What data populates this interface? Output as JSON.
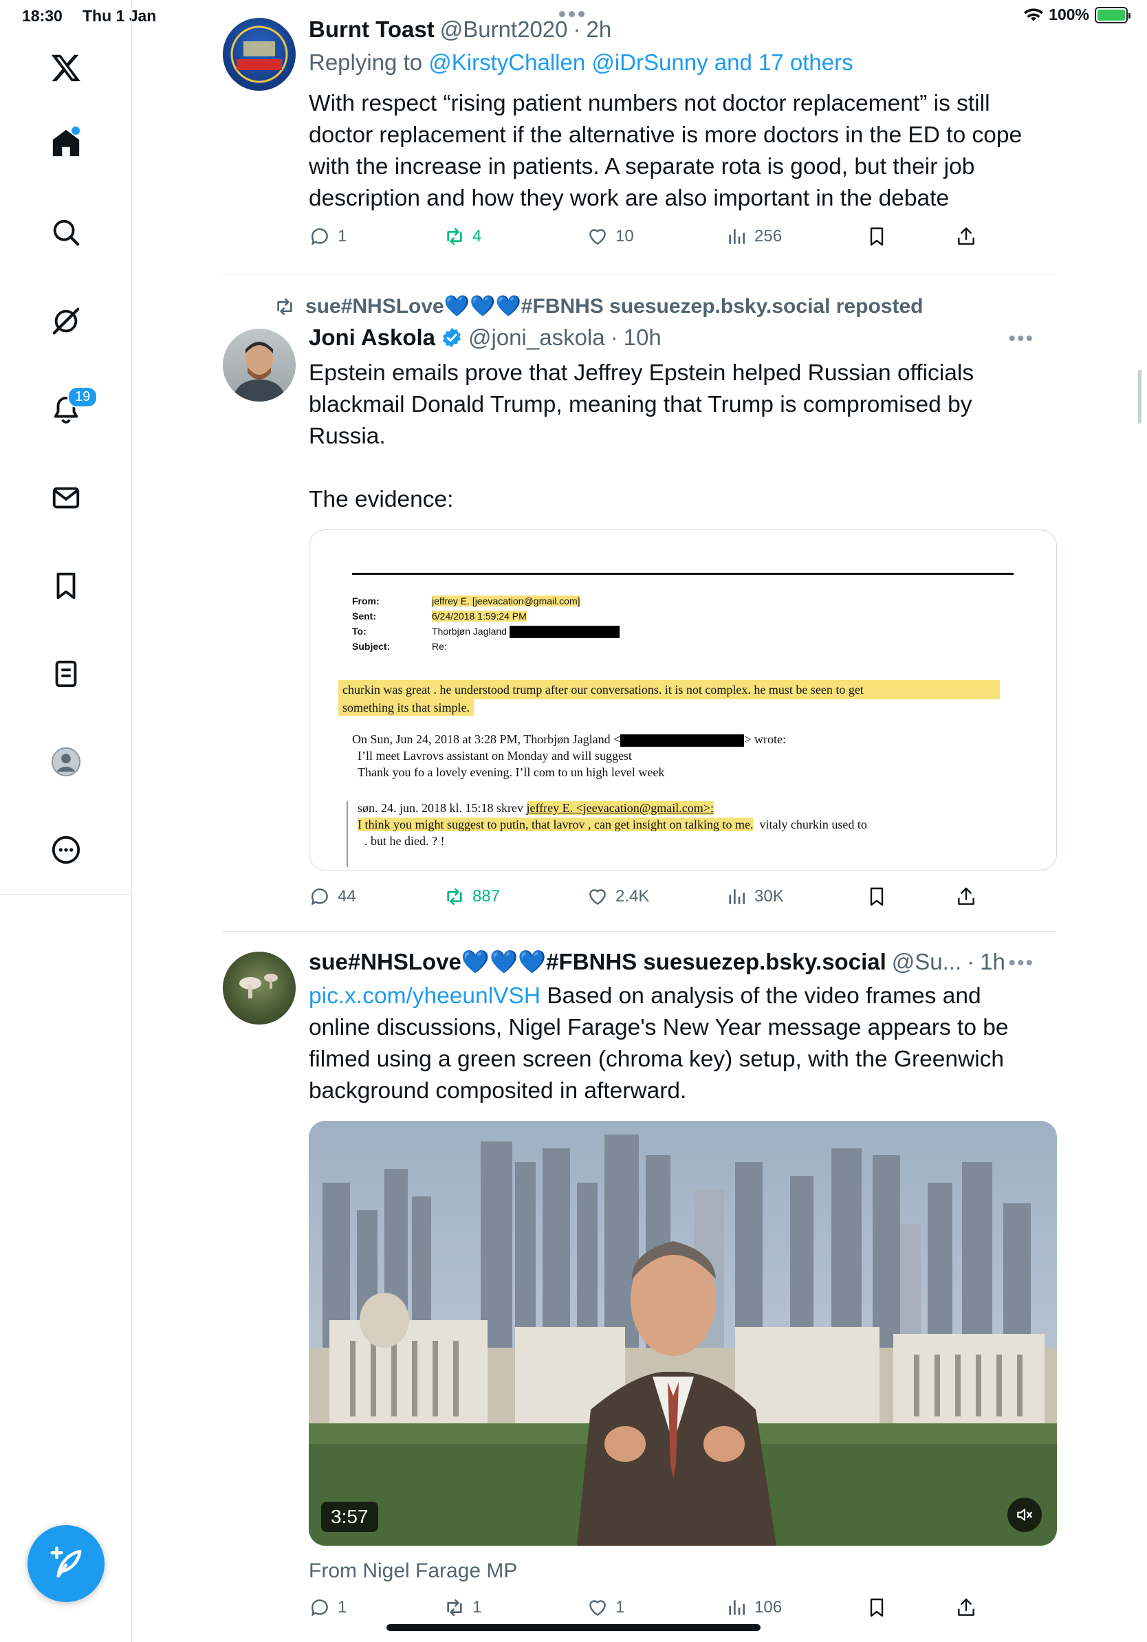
{
  "status_bar": {
    "time": "18:30",
    "date": "Thu 1 Jan",
    "battery": "100%"
  },
  "sidebar": {
    "notifications_badge": "19",
    "items": [
      "x-logo",
      "home",
      "search",
      "grok",
      "notifications",
      "messages",
      "bookmarks",
      "lists",
      "profile",
      "more"
    ]
  },
  "tweets": [
    {
      "name": "Burnt Toast",
      "handle": "@Burnt2020",
      "time": "2h",
      "replying_prefix": "Replying to",
      "replying_to": "@KirstyChallen @iDrSunny and 17 others",
      "text_lines": [
        "With respect “rising patient numbers not doctor replacement” is still",
        "doctor replacement if the alternative is more doctors in the ED to cope",
        "with the increase in patients. A separate rota is good, but their job",
        "description and how they work are also important in the debate"
      ],
      "replies": "1",
      "reposts": "4",
      "likes": "10",
      "views": "256"
    },
    {
      "repost_label": "sue#NHSLove💙💙💙#FBNHS suesuezep.bsky.social reposted",
      "name": "Joni Askola",
      "handle": "@joni_askola",
      "time": "10h",
      "text_lines": [
        "Epstein emails prove that Jeffrey Epstein helped Russian officials",
        "blackmail Donald Trump, meaning that Trump is compromised by",
        "Russia.",
        "",
        "The evidence:"
      ],
      "email": {
        "from_label": "From:",
        "from_value": "jeffrey E. [jeevacation@gmail.com]",
        "sent_label": "Sent:",
        "sent_value": "6/24/2018 1:59:24 PM",
        "to_label": "To:",
        "to_value": "Thorbjøn Jagland",
        "subject_label": "Subject:",
        "subject_value": "Re:",
        "line1": "churkin was great .   he understood trump after our conversations.     it is not complex.    he must be seen to get",
        "line2": "something    its that simple.",
        "line3a": "On Sun, Jun 24, 2018 at 3:28 PM, Thorbjøn Jagland <",
        "line3b": "> wrote:",
        "line4": "I’ll meet Lavrovs assistant on Monday and will suggest",
        "line5": "Thank you fo a lovely evening. I’ll com to un high level week",
        "line6a": "søn. 24. jun. 2018 kl. 15:18 skrev ",
        "line6b": "jeffrey E. <jeevacation@gmail.com>:",
        "line7a": "I think you might suggest to putin,  that lavrov , can get insight on talking to me.",
        "line7b": "vitaly churkin  used to",
        "line8": ".  but  he died. ? !"
      },
      "replies": "44",
      "reposts": "887",
      "likes": "2.4K",
      "views": "30K"
    },
    {
      "name": "sue#NHSLove💙💙💙#FBNHS suesuezep.bsky.social",
      "handle": "@Su...",
      "time": "1h",
      "link": "pic.x.com/yheeunlVSH",
      "text_first": " Based on analysis of the video frames and",
      "text_lines": [
        "online discussions, Nigel Farage's New Year message appears to be",
        "filmed using a green screen (chroma key) setup, with the Greenwich",
        "background composited in afterward."
      ],
      "video_duration": "3:57",
      "from_line": "From Nigel Farage MP",
      "replies": "1",
      "reposts": "1",
      "likes": "1",
      "views": "106"
    }
  ],
  "colors": {
    "accent": "#1d9bf0",
    "repost_green": "#00ba7c",
    "muted": "#536471",
    "highlight": "#f7e27a"
  }
}
